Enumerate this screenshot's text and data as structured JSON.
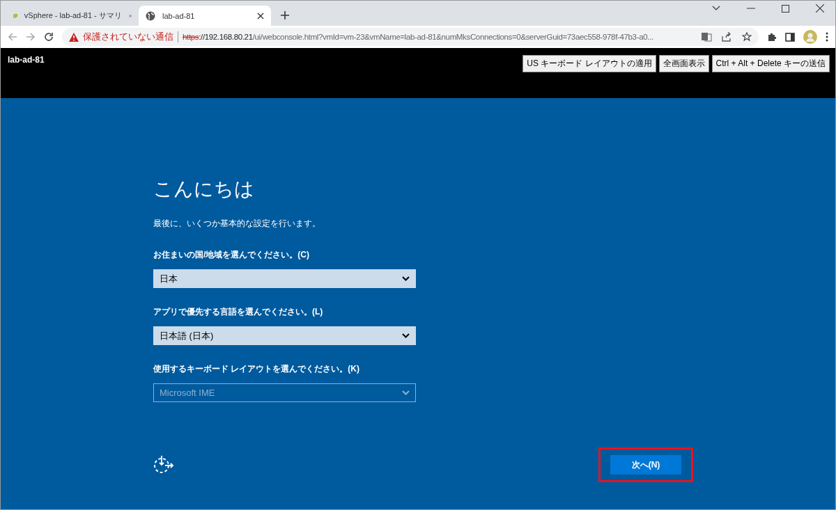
{
  "browser": {
    "tabs": [
      {
        "title": "vSphere - lab-ad-81 - サマリ",
        "kind": "vsphere",
        "selected": false
      },
      {
        "title": "lab-ad-81",
        "kind": "globe",
        "selected": true
      }
    ],
    "security_warning": "保護されていない通信",
    "url": {
      "scheme": "https",
      "host": "://192.168.80.21",
      "path": "/ui/webconsole.html?vmId=vm-23&vmName=lab-ad-81&numMksConnections=0&serverGuid=73aec558-978f-47b3-a0..."
    }
  },
  "console": {
    "vm_name": "lab-ad-81",
    "buttons": [
      "US キーボード レイアウトの適用",
      "全画面表示",
      "Ctrl + Alt + Delete キーの送信"
    ]
  },
  "setup": {
    "title": "こんにちは",
    "subtitle": "最後に、いくつか基本的な設定を行います。",
    "fields": [
      {
        "label": "お住まいの国/地域を選んでください。(C)",
        "value": "日本",
        "disabled": false
      },
      {
        "label": "アプリで優先する言語を選んでください。(L)",
        "value": "日本語 (日本)",
        "disabled": false
      },
      {
        "label": "使用するキーボード レイアウトを選んでください。(K)",
        "value": "Microsoft IME",
        "disabled": true
      }
    ],
    "next_button": {
      "label": "次へ(N)",
      "highlighted": true
    }
  }
}
